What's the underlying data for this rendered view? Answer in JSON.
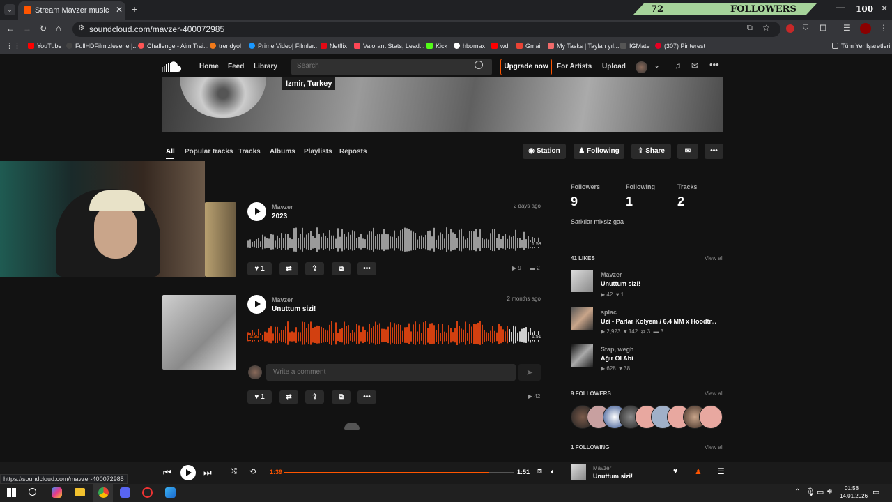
{
  "browser": {
    "tab_title": "Stream Mavzer music | Listen to",
    "url": "soundcloud.com/mavzer-400072985",
    "bookmarks": [
      "YouTube",
      "FullHDFilmizlesene |...",
      "Challenge - Aim Trai...",
      "trendyol",
      "Prime Video| Filmler...",
      "Netflix",
      "Valorant Stats, Lead...",
      "Kick",
      "hbomax",
      "wd",
      "Gmail",
      "My Tasks | Taylan yıl...",
      "IGMate",
      "(307) Pinterest"
    ],
    "all_bookmarks": "Tüm Yer İşaretleri",
    "status_url": "https://soundcloud.com/mavzer-400072985"
  },
  "overlay": {
    "count": "72",
    "label": "FOLLOWERS",
    "goal": "100"
  },
  "nav": {
    "home": "Home",
    "feed": "Feed",
    "library": "Library",
    "search_placeholder": "Search",
    "upgrade": "Upgrade now",
    "for_artists": "For Artists",
    "upload": "Upload"
  },
  "profile": {
    "location": "Izmir, Turkey"
  },
  "tabs": [
    "All",
    "Popular tracks",
    "Tracks",
    "Albums",
    "Playlists",
    "Reposts"
  ],
  "actions": {
    "station": "Station",
    "following": "Following",
    "share": "Share"
  },
  "tracks": [
    {
      "user": "Mavzer",
      "title": "2023",
      "ago": "2 days ago",
      "likes": "1",
      "plays": "9",
      "comments": "2",
      "duration": "1:58"
    },
    {
      "user": "Mavzer",
      "title": "Unuttum sizi!",
      "ago": "2 months ago",
      "likes": "1",
      "plays": "42",
      "position": "1:39",
      "duration": "1:51",
      "comment_placeholder": "Write a comment",
      "progress": 0.89
    }
  ],
  "sidebar": {
    "followers_label": "Followers",
    "followers": "9",
    "following_label": "Following",
    "following": "1",
    "tracks_label": "Tracks",
    "tracks": "2",
    "bio": "Sarkılar mixsiz gaa",
    "likes_head": "41 LIKES",
    "view_all": "View all",
    "likes": [
      {
        "user": "Mavzer",
        "title": "Unuttum sizi!",
        "plays": "42",
        "likes": "1"
      },
      {
        "user": "splac",
        "title": "Uzi - Parlar Kolyem / 6.4 MM x Hoodtr...",
        "plays": "2,923",
        "likes": "142",
        "reposts": "3",
        "comments": "3"
      },
      {
        "user": "Stap, wegh",
        "title": "Ağır Ol Abi",
        "plays": "628",
        "likes": "38"
      }
    ],
    "followers_head": "9 FOLLOWERS",
    "following_head": "1 FOLLOWING"
  },
  "player": {
    "position": "1:39",
    "duration": "1:51",
    "user": "Mavzer",
    "title": "Unuttum sizi!",
    "progress": 0.89
  },
  "taskbar": {
    "time": "01:58",
    "date": "14.01.2026"
  },
  "colors": {
    "accent": "#ff5500",
    "overlay": "#a6d39a"
  }
}
